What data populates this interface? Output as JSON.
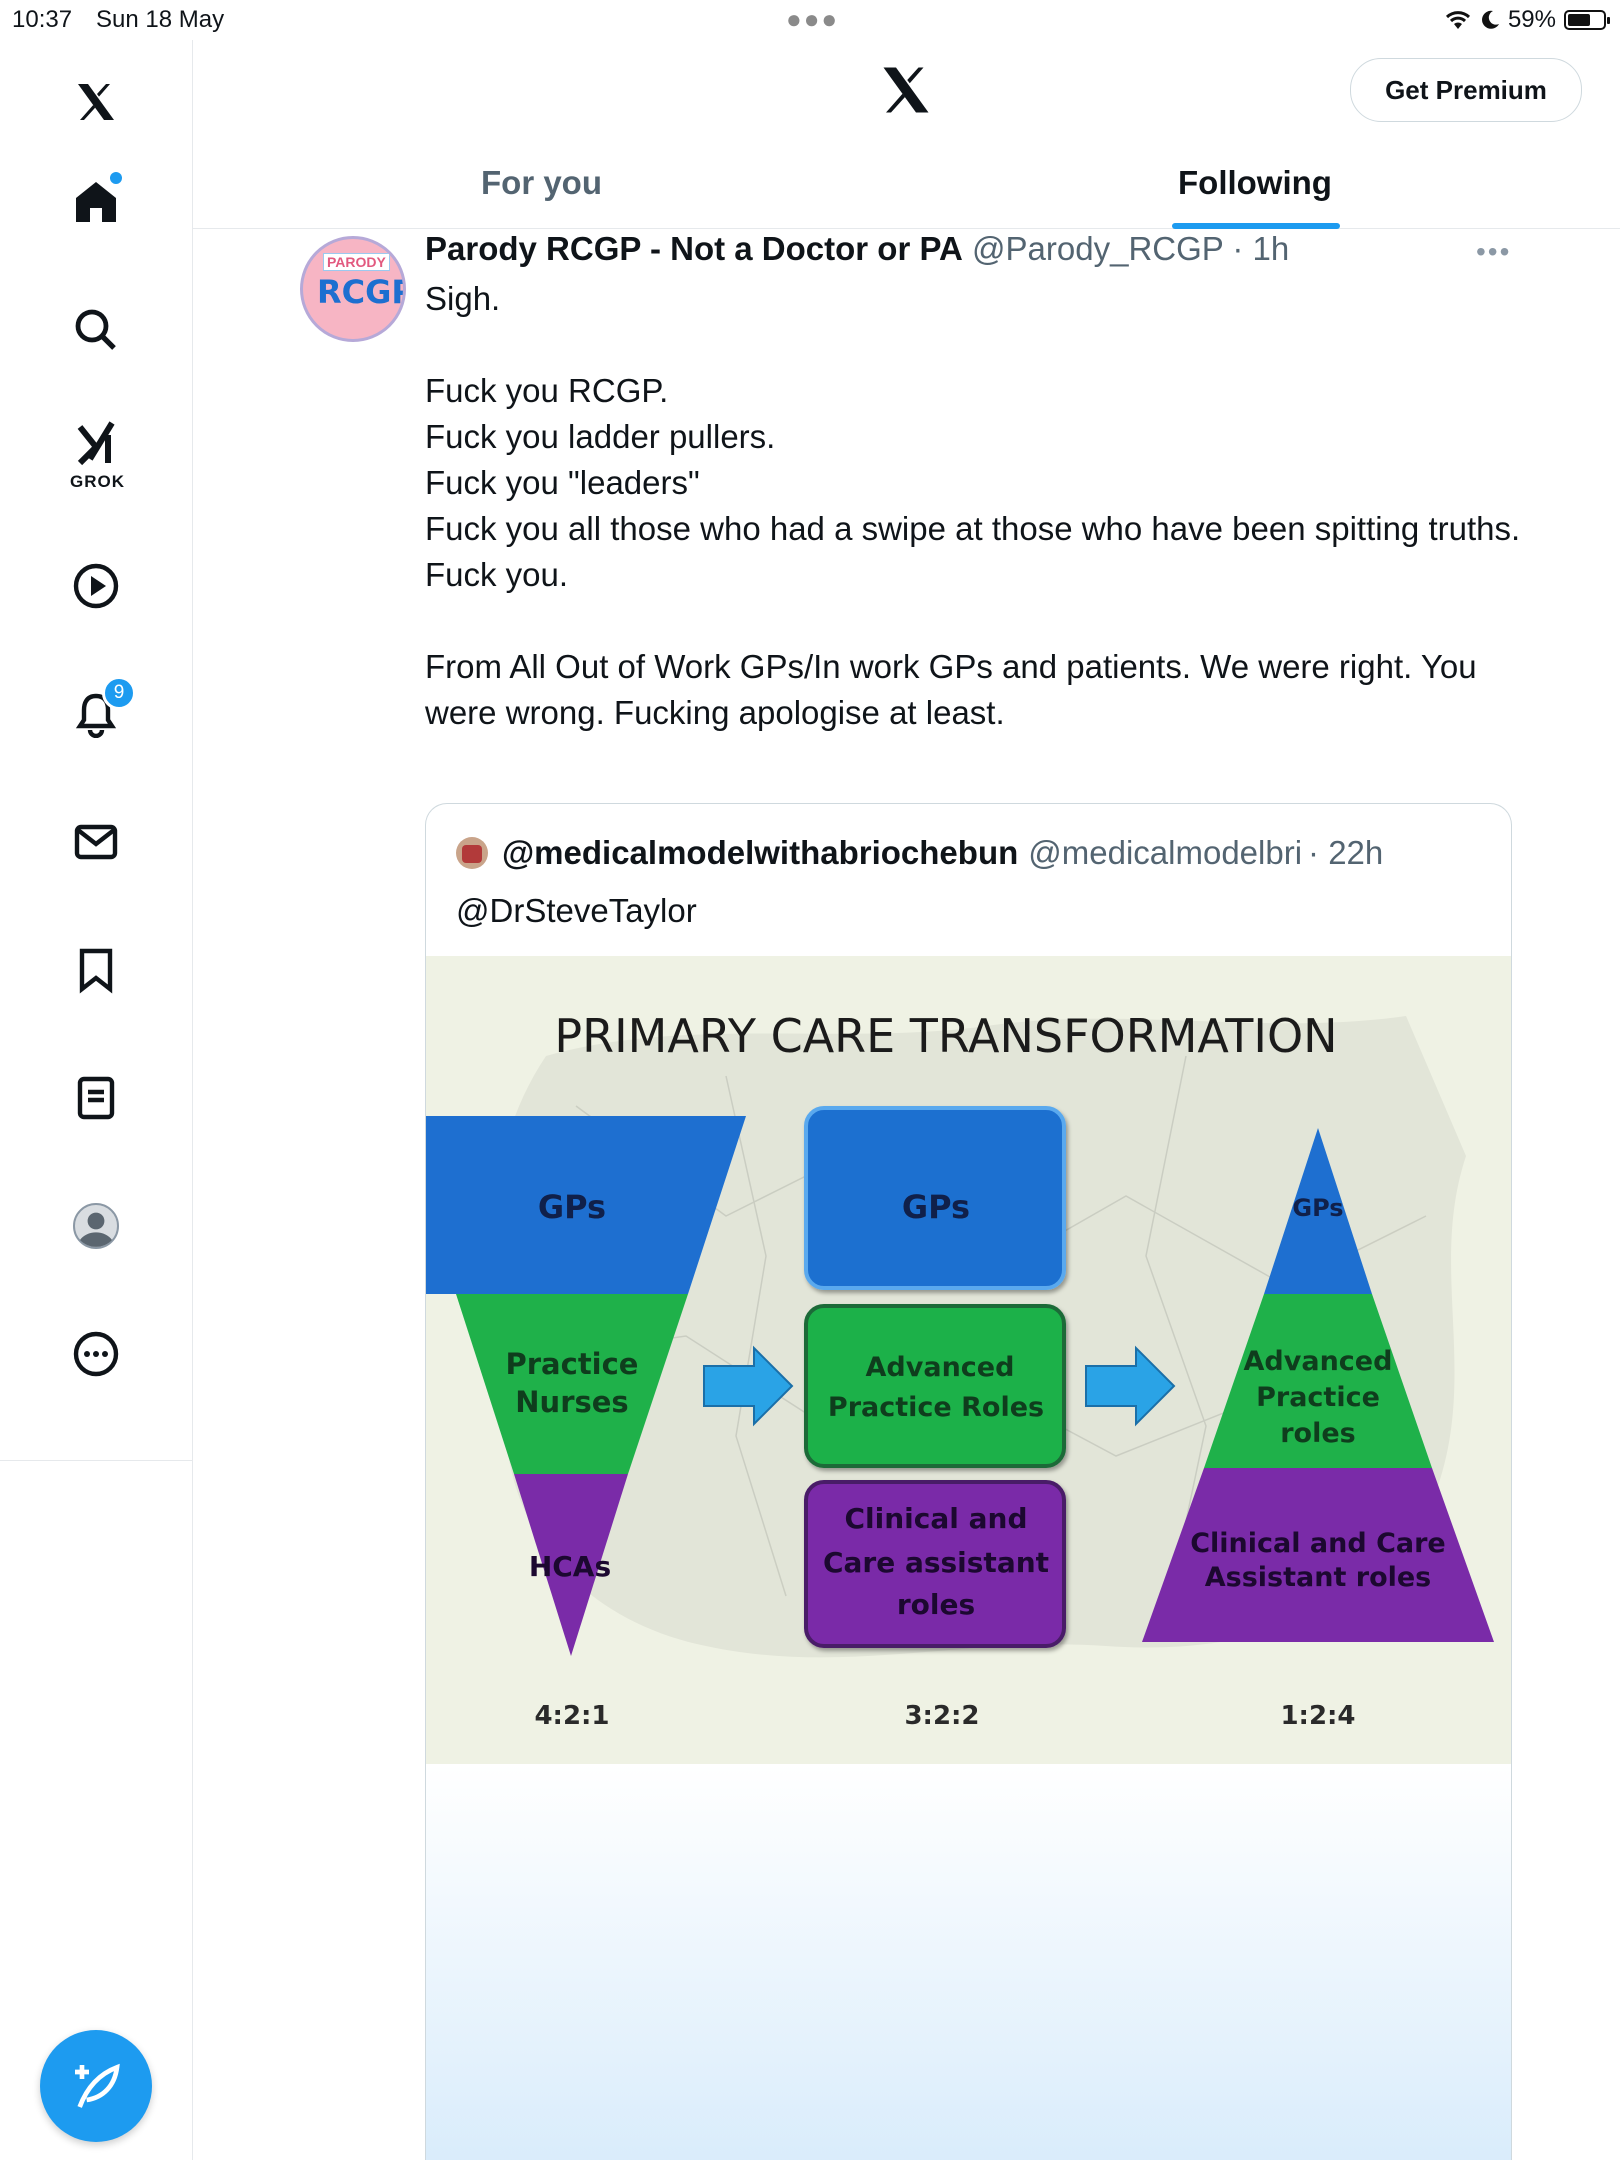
{
  "status_bar": {
    "time": "10:37",
    "date": "Sun 18 May",
    "battery": "59%"
  },
  "sidebar": {
    "grok_label": "GROK",
    "notifications_count": "9",
    "items": [
      "home-icon",
      "search-icon",
      "grok-icon",
      "video-icon",
      "notifications-icon",
      "messages-icon",
      "bookmarks-icon",
      "lists-icon",
      "profile-icon",
      "more-icon"
    ]
  },
  "header": {
    "premium_label": "Get Premium"
  },
  "tabs": [
    {
      "label": "For you",
      "active": false
    },
    {
      "label": "Following",
      "active": true
    }
  ],
  "tweet": {
    "name": "Parody RCGP - Not a Doctor or PA",
    "handle": "@Parody_RCGP",
    "time": "· 1h",
    "avatar_top": "PARODY",
    "avatar_main": "RCGP",
    "lines": {
      "l1": "Sigh.",
      "l2": "Fuck you RCGP.",
      "l3": "Fuck you ladder pullers.",
      "l4": "Fuck you \"leaders\"",
      "l5": "Fuck you all those who had a swipe at those who have been spitting truths.",
      "l6": "Fuck you.",
      "l7": "From All Out of Work GPs/In work GPs and patients. We were right. You were wrong. Fucking apologise at least."
    }
  },
  "quote": {
    "name": "@medicalmodelwithabriochebun",
    "handle": "@medicalmodelbri",
    "time": "· 22h",
    "reply_to": "@DrSteveTaylor",
    "image": {
      "title": "PRIMARY CARE TRANSFORMATION",
      "left": {
        "top": "GPs",
        "mid1": "Practice",
        "mid2": "Nurses",
        "bottom": "HCAs",
        "ratio": "4:2:1"
      },
      "center": {
        "top": "GPs",
        "mid1": "Advanced",
        "mid2": "Practice Roles",
        "bot1": "Clinical and",
        "bot2": "Care assistant",
        "bot3": "roles",
        "ratio": "3:2:2"
      },
      "right": {
        "top": "GPs",
        "mid1": "Advanced",
        "mid2": "Practice",
        "mid3": "roles",
        "bot1": "Clinical and Care",
        "bot2": "Assistant roles",
        "ratio": "1:2:4"
      },
      "colors": {
        "blue": "#1e6fd0",
        "green": "#1fb14a",
        "purple": "#7a2ba8",
        "arrow": "#2aa3e6"
      }
    }
  },
  "colors": {
    "accent": "#1d9bf0",
    "text": "#0f1419",
    "muted": "#536471"
  }
}
